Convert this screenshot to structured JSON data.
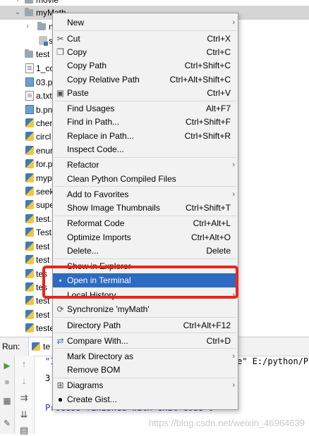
{
  "tree": {
    "rows": [
      {
        "name": "movie",
        "icon": "folder",
        "chev": "›"
      },
      {
        "name": "myMath",
        "icon": "folder",
        "chev": "⌄"
      },
      {
        "name": "n",
        "icon": "folder",
        "chev": "›"
      },
      {
        "name": "s",
        "icon": "init",
        "chev": ""
      },
      {
        "name": "test",
        "icon": "folder",
        "chev": ""
      },
      {
        "name": "1_co",
        "icon": "txt",
        "chev": ""
      },
      {
        "name": "03.p",
        "icon": "img",
        "chev": ""
      },
      {
        "name": "a.txt",
        "icon": "txt",
        "chev": ""
      },
      {
        "name": "b.pn",
        "icon": "img",
        "chev": ""
      },
      {
        "name": "chen",
        "icon": "py",
        "chev": ""
      },
      {
        "name": "circl",
        "icon": "py",
        "chev": ""
      },
      {
        "name": "enur",
        "icon": "py",
        "chev": ""
      },
      {
        "name": "for.p",
        "icon": "py",
        "chev": ""
      },
      {
        "name": "myp",
        "icon": "py",
        "chev": ""
      },
      {
        "name": "seek",
        "icon": "py",
        "chev": ""
      },
      {
        "name": "supe",
        "icon": "py",
        "chev": ""
      },
      {
        "name": "test.",
        "icon": "py",
        "chev": ""
      },
      {
        "name": "Test",
        "icon": "py",
        "chev": ""
      },
      {
        "name": "test",
        "icon": "py",
        "chev": ""
      },
      {
        "name": "test",
        "icon": "py",
        "chev": ""
      },
      {
        "name": "tes",
        "icon": "py",
        "chev": ""
      },
      {
        "name": "tes",
        "icon": "py",
        "chev": ""
      },
      {
        "name": "test",
        "icon": "py",
        "chev": ""
      },
      {
        "name": "test",
        "icon": "py",
        "chev": ""
      },
      {
        "name": "teste",
        "icon": "py",
        "chev": ""
      }
    ]
  },
  "run_panel": {
    "label": "Run:",
    "tab_label": "te",
    "console_line1_left": "\"I",
    "console_line1_right": "e\" E:/python/P",
    "console_line2": "3.",
    "console_line3": "Process finished with exit code 0",
    "watermark": "https://blog.csdn.net/weixin_46964639"
  },
  "menu": {
    "items": [
      {
        "label": "New",
        "shortcut": "",
        "icon": "",
        "submenu": true
      },
      {
        "label": "Cut",
        "shortcut": "Ctrl+X",
        "icon": "scissors-icon",
        "submenu": false
      },
      {
        "label": "Copy",
        "shortcut": "Ctrl+C",
        "icon": "copy-icon",
        "submenu": false
      },
      {
        "label": "Copy Path",
        "shortcut": "Ctrl+Shift+C",
        "icon": "",
        "submenu": false
      },
      {
        "label": "Copy Relative Path",
        "shortcut": "Ctrl+Alt+Shift+C",
        "icon": "",
        "submenu": false
      },
      {
        "label": "Paste",
        "shortcut": "Ctrl+V",
        "icon": "paste-icon",
        "submenu": false
      },
      {
        "label": "Find Usages",
        "shortcut": "Alt+F7",
        "icon": "",
        "submenu": false
      },
      {
        "label": "Find in Path...",
        "shortcut": "Ctrl+Shift+F",
        "icon": "",
        "submenu": false
      },
      {
        "label": "Replace in Path...",
        "shortcut": "Ctrl+Shift+R",
        "icon": "",
        "submenu": false
      },
      {
        "label": "Inspect Code...",
        "shortcut": "",
        "icon": "",
        "submenu": false
      },
      {
        "label": "Refactor",
        "shortcut": "",
        "icon": "",
        "submenu": true
      },
      {
        "label": "Clean Python Compiled Files",
        "shortcut": "",
        "icon": "",
        "submenu": false
      },
      {
        "label": "Add to Favorites",
        "shortcut": "",
        "icon": "",
        "submenu": true
      },
      {
        "label": "Show Image Thumbnails",
        "shortcut": "Ctrl+Shift+T",
        "icon": "",
        "submenu": false
      },
      {
        "label": "Reformat Code",
        "shortcut": "Ctrl+Alt+L",
        "icon": "",
        "submenu": false
      },
      {
        "label": "Optimize Imports",
        "shortcut": "Ctrl+Alt+O",
        "icon": "",
        "submenu": false
      },
      {
        "label": "Delete...",
        "shortcut": "Delete",
        "icon": "",
        "submenu": false
      },
      {
        "label": "Show in Explorer",
        "shortcut": "",
        "icon": "",
        "submenu": false
      },
      {
        "label": "Open in Terminal",
        "shortcut": "",
        "icon": "terminal-icon",
        "submenu": false
      },
      {
        "label": "Local History",
        "shortcut": "",
        "icon": "",
        "submenu": true
      },
      {
        "label": "Synchronize 'myMath'",
        "shortcut": "",
        "icon": "sync-icon",
        "submenu": false
      },
      {
        "label": "Directory Path",
        "shortcut": "Ctrl+Alt+F12",
        "icon": "",
        "submenu": false
      },
      {
        "label": "Compare With...",
        "shortcut": "Ctrl+D",
        "icon": "compare-icon",
        "submenu": false
      },
      {
        "label": "Mark Directory as",
        "shortcut": "",
        "icon": "",
        "submenu": true
      },
      {
        "label": "Remove BOM",
        "shortcut": "",
        "icon": "",
        "submenu": false
      },
      {
        "label": "Diagrams",
        "shortcut": "",
        "icon": "diagram-icon",
        "submenu": true
      },
      {
        "label": "Create Gist...",
        "shortcut": "",
        "icon": "github-icon",
        "submenu": false
      }
    ],
    "highlighted": "Open in Terminal",
    "accent_color": "#2d6bc1",
    "annotation_color": "#e8261d"
  }
}
